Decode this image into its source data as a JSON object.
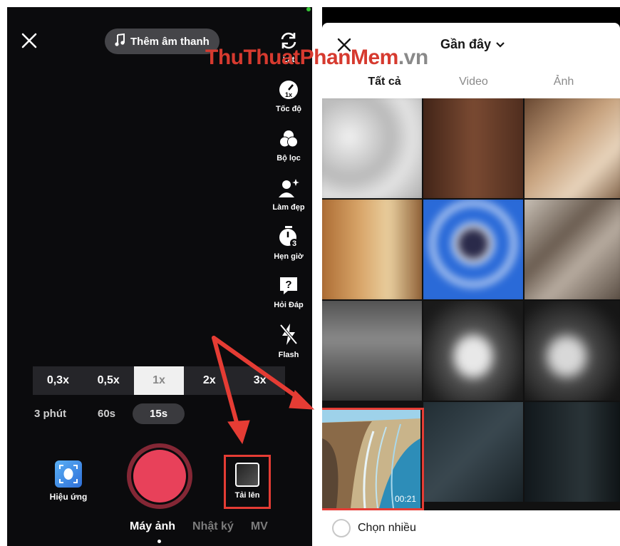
{
  "camera": {
    "sound_label": "Thêm âm thanh",
    "tools": [
      {
        "label": "Lật",
        "icon": "flip-camera-icon"
      },
      {
        "label": "Tốc độ",
        "icon": "speed-icon",
        "badge": "1x"
      },
      {
        "label": "Bộ lọc",
        "icon": "filters-icon"
      },
      {
        "label": "Làm đẹp",
        "icon": "beautify-icon"
      },
      {
        "label": "Hẹn giờ",
        "icon": "timer-icon",
        "badge": "3"
      },
      {
        "label": "Hỏi Đáp",
        "icon": "qa-icon",
        "badge": "?"
      },
      {
        "label": "Flash",
        "icon": "flash-off-icon"
      }
    ],
    "zoom_options": [
      "0,3x",
      "0,5x",
      "1x",
      "2x",
      "3x"
    ],
    "zoom_selected": "1x",
    "durations": [
      "3 phút",
      "60s",
      "15s"
    ],
    "duration_selected": "15s",
    "effects_label": "Hiệu ứng",
    "upload_label": "Tải lên",
    "nav": [
      "Máy ảnh",
      "Nhật ký",
      "MV"
    ],
    "nav_selected": "Máy ảnh"
  },
  "gallery": {
    "title": "Gần đây",
    "tabs": [
      "Tất cả",
      "Video",
      "Ảnh"
    ],
    "tab_selected": "Tất cả",
    "selected_duration": "00:21",
    "multi_select_label": "Chọn nhiều"
  },
  "watermark": {
    "part_a": "ThuThuat",
    "part_b": "PhanMem",
    "part_c": ".vn"
  },
  "colors": {
    "record": "#e8415a",
    "highlight": "#e53c34",
    "accent_blue": "#2f6fd8"
  }
}
